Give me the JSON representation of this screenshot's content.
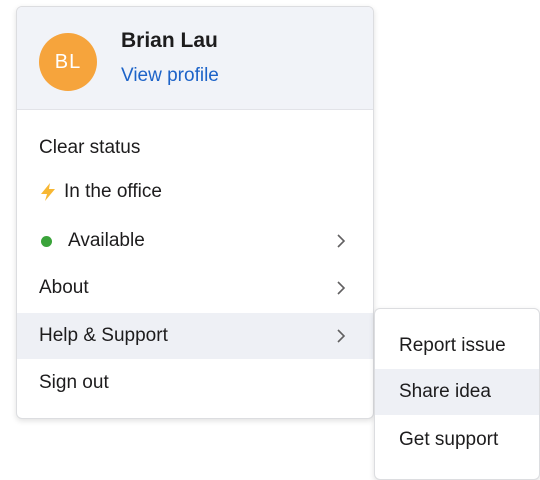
{
  "profile": {
    "initials": "BL",
    "name": "Brian Lau",
    "view_profile": "View profile",
    "avatar_color": "#f6a43c"
  },
  "menu": {
    "clear_status": "Clear status",
    "status_text": "In the office",
    "status_icon": "lightning-bolt-icon",
    "availability": "Available",
    "availability_color": "#3aa33a",
    "about": "About",
    "help_support": "Help & Support",
    "sign_out": "Sign out"
  },
  "submenu": {
    "report_issue": "Report issue",
    "share_idea": "Share idea",
    "get_support": "Get support"
  }
}
